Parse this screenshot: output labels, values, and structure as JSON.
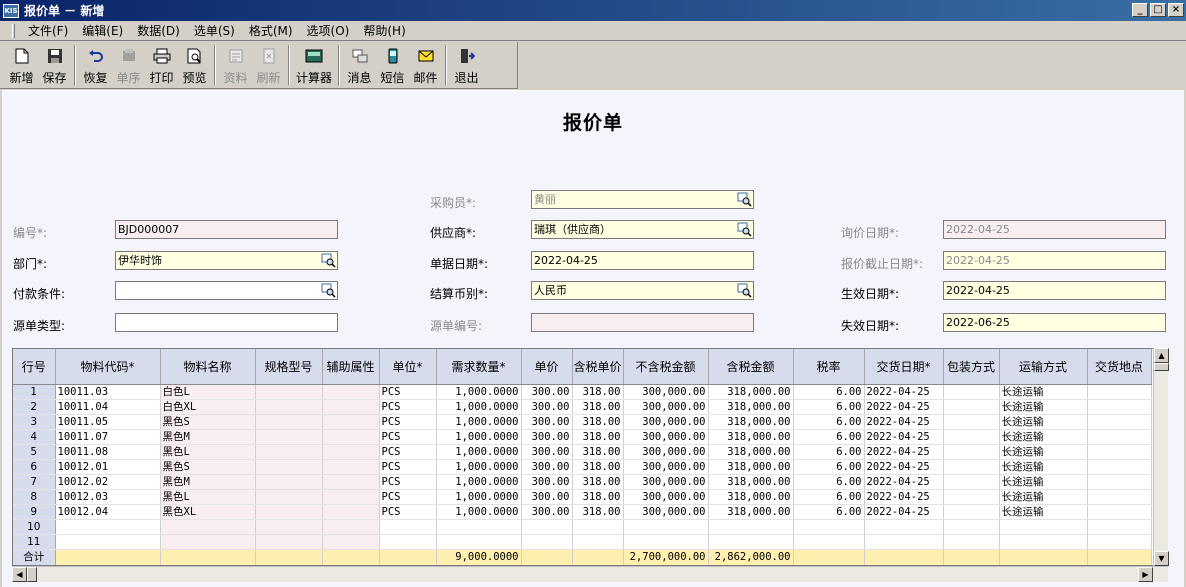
{
  "window": {
    "logo": "KIS",
    "title": "报价单 － 新增",
    "controls": [
      "_",
      "□",
      "×"
    ]
  },
  "menu": [
    "文件(F)",
    "编辑(E)",
    "数据(D)",
    "选单(S)",
    "格式(M)",
    "选项(O)",
    "帮助(H)"
  ],
  "toolbar": {
    "new": "新增",
    "save": "保存",
    "restore": "恢复",
    "sequence": "单序",
    "print": "打印",
    "preview": "预览",
    "info": "资料",
    "refresh": "刷新",
    "calculator": "计算器",
    "message": "消息",
    "sms": "短信",
    "mail": "邮件",
    "exit": "退出"
  },
  "form": {
    "title": "报价单",
    "buyer_label": "采购员*:",
    "buyer": "黄丽",
    "number_label": "编号*:",
    "number": "BJD000007",
    "supplier_label": "供应商*:",
    "supplier": "瑞琪（供应商）",
    "inquiry_date_label": "询价日期*:",
    "inquiry_date": "2022-04-25",
    "dept_label": "部门*:",
    "dept": "伊华时饰",
    "doc_date_label": "单据日期*:",
    "doc_date": "2022-04-25",
    "quote_deadline_label": "报价截止日期*:",
    "quote_deadline": "2022-04-25",
    "payment_label": "付款条件:",
    "payment": "",
    "currency_label": "结算币别*:",
    "currency": "人民币",
    "effective_date_label": "生效日期*:",
    "effective_date": "2022-04-25",
    "source_type_label": "源单类型:",
    "source_type": "",
    "source_no_label": "源单编号:",
    "source_no": "",
    "expire_date_label": "失效日期*:",
    "expire_date": "2022-06-25"
  },
  "grid": {
    "headers": [
      "行号",
      "物料代码*",
      "物料名称",
      "规格型号",
      "辅助属性",
      "单位*",
      "需求数量*",
      "单价",
      "含税单价",
      "不含税金额",
      "含税金额",
      "税率",
      "交货日期*",
      "包装方式",
      "运输方式",
      "交货地点"
    ],
    "rows": [
      [
        "1",
        "10011.03",
        "白色L",
        "",
        "",
        "PCS",
        "1,000.0000",
        "300.00",
        "318.00",
        "300,000.00",
        "318,000.00",
        "6.00",
        "2022-04-25",
        "",
        "长途运输",
        ""
      ],
      [
        "2",
        "10011.04",
        "白色XL",
        "",
        "",
        "PCS",
        "1,000.0000",
        "300.00",
        "318.00",
        "300,000.00",
        "318,000.00",
        "6.00",
        "2022-04-25",
        "",
        "长途运输",
        ""
      ],
      [
        "3",
        "10011.05",
        "黑色S",
        "",
        "",
        "PCS",
        "1,000.0000",
        "300.00",
        "318.00",
        "300,000.00",
        "318,000.00",
        "6.00",
        "2022-04-25",
        "",
        "长途运输",
        ""
      ],
      [
        "4",
        "10011.07",
        "黑色M",
        "",
        "",
        "PCS",
        "1,000.0000",
        "300.00",
        "318.00",
        "300,000.00",
        "318,000.00",
        "6.00",
        "2022-04-25",
        "",
        "长途运输",
        ""
      ],
      [
        "5",
        "10011.08",
        "黑色L",
        "",
        "",
        "PCS",
        "1,000.0000",
        "300.00",
        "318.00",
        "300,000.00",
        "318,000.00",
        "6.00",
        "2022-04-25",
        "",
        "长途运输",
        ""
      ],
      [
        "6",
        "10012.01",
        "黑色S",
        "",
        "",
        "PCS",
        "1,000.0000",
        "300.00",
        "318.00",
        "300,000.00",
        "318,000.00",
        "6.00",
        "2022-04-25",
        "",
        "长途运输",
        ""
      ],
      [
        "7",
        "10012.02",
        "黑色M",
        "",
        "",
        "PCS",
        "1,000.0000",
        "300.00",
        "318.00",
        "300,000.00",
        "318,000.00",
        "6.00",
        "2022-04-25",
        "",
        "长途运输",
        ""
      ],
      [
        "8",
        "10012.03",
        "黑色L",
        "",
        "",
        "PCS",
        "1,000.0000",
        "300.00",
        "318.00",
        "300,000.00",
        "318,000.00",
        "6.00",
        "2022-04-25",
        "",
        "长途运输",
        ""
      ],
      [
        "9",
        "10012.04",
        "黑色XL",
        "",
        "",
        "PCS",
        "1,000.0000",
        "300.00",
        "318.00",
        "300,000.00",
        "318,000.00",
        "6.00",
        "2022-04-25",
        "",
        "长途运输",
        ""
      ],
      [
        "10",
        "",
        "",
        "",
        "",
        "",
        "",
        "",
        "",
        "",
        "",
        "",
        "",
        "",
        "",
        ""
      ],
      [
        "11",
        "",
        "",
        "",
        "",
        "",
        "",
        "",
        "",
        "",
        "",
        "",
        "",
        "",
        "",
        ""
      ]
    ],
    "total": [
      "合计",
      "",
      "",
      "",
      "",
      "",
      "9,000.0000",
      "",
      "",
      "2,700,000.00",
      "2,862,000.00",
      "",
      "",
      "",
      "",
      ""
    ]
  },
  "colors": {
    "title_bar_start": "#0a246a",
    "title_bar_end": "#3a6ea5",
    "form_bg": "#f4f4fc",
    "required_field": "#ffffe1",
    "readonly_field": "#f8eef0",
    "grid_header": "#d6dceb",
    "total_row": "#fff0b0"
  }
}
